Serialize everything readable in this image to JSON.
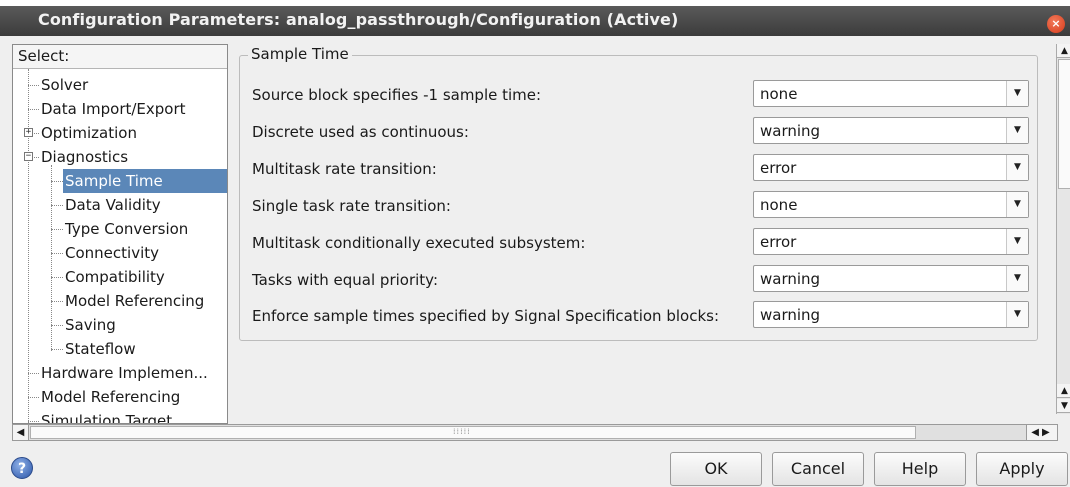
{
  "window": {
    "title": "Configuration Parameters: analog_passthrough/Configuration (Active)"
  },
  "tree": {
    "header": "Select:",
    "items": [
      {
        "label": "Solver"
      },
      {
        "label": "Data Import/Export"
      },
      {
        "label": "Optimization",
        "expander": "+"
      },
      {
        "label": "Diagnostics",
        "expander": "−"
      },
      {
        "label": "Sample Time",
        "selected": true
      },
      {
        "label": "Data Validity"
      },
      {
        "label": "Type Conversion"
      },
      {
        "label": "Connectivity"
      },
      {
        "label": "Compatibility"
      },
      {
        "label": "Model Referencing"
      },
      {
        "label": "Saving"
      },
      {
        "label": "Stateflow"
      },
      {
        "label": "Hardware Implemen..."
      },
      {
        "label": "Model Referencing"
      },
      {
        "label": "Simulation Target"
      }
    ]
  },
  "group": {
    "title": "Sample Time",
    "params": [
      {
        "label": "Source block specifies -1 sample time:",
        "value": "none"
      },
      {
        "label": "Discrete used as continuous:",
        "value": "warning"
      },
      {
        "label": "Multitask rate transition:",
        "value": "error"
      },
      {
        "label": "Single task rate transition:",
        "value": "none"
      },
      {
        "label": "Multitask conditionally executed subsystem:",
        "value": "error"
      },
      {
        "label": "Tasks with equal priority:",
        "value": "warning"
      },
      {
        "label": "Enforce sample times specified by Signal Specification blocks:",
        "value": "warning"
      }
    ]
  },
  "buttons": {
    "ok": "OK",
    "cancel": "Cancel",
    "help": "Help",
    "apply": "Apply"
  },
  "icons": {
    "help": "?",
    "close": "×"
  }
}
